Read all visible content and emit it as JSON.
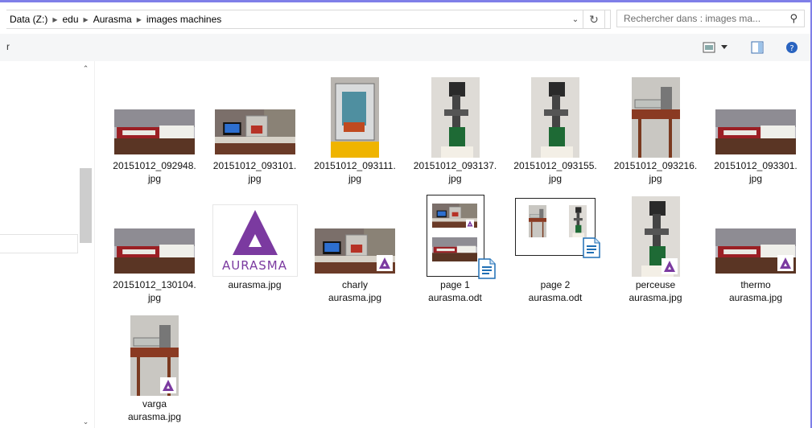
{
  "breadcrumb": [
    "Data (Z:)",
    "edu",
    "Aurasma",
    "images machines"
  ],
  "search": {
    "placeholder": "Rechercher dans : images ma..."
  },
  "toolbar": {
    "truncated_label": "r"
  },
  "colors": {
    "accent_border": "#7f7fe8",
    "aurasma_purple": "#7b3aa0",
    "scrollbar_thumb": "#cdcdcd"
  },
  "icons": [
    "chevron-right-icon",
    "dropdown-arrow-icon",
    "refresh-icon",
    "search-icon",
    "view-options-icon",
    "preview-pane-icon",
    "help-icon",
    "writer-document-icon",
    "aurasma-badge-icon"
  ],
  "files": [
    {
      "line1": "20151012_092948.",
      "line2": "jpg",
      "thumb": "wide-table",
      "badge": false
    },
    {
      "line1": "20151012_093101.",
      "line2": "jpg",
      "thumb": "wide-computer",
      "badge": false
    },
    {
      "line1": "20151012_093111.",
      "line2": "jpg",
      "thumb": "tall-machine-box",
      "badge": false
    },
    {
      "line1": "20151012_093137.",
      "line2": "jpg",
      "thumb": "tall-drill",
      "badge": false
    },
    {
      "line1": "20151012_093155.",
      "line2": "jpg",
      "thumb": "tall-drill",
      "badge": false
    },
    {
      "line1": "20151012_093216.",
      "line2": "jpg",
      "thumb": "tall-bench",
      "badge": false
    },
    {
      "line1": "20151012_093301.",
      "line2": "jpg",
      "thumb": "wide-table",
      "badge": false
    },
    {
      "line1": "20151012_130104.",
      "line2": "jpg",
      "thumb": "wide-table",
      "badge": false
    },
    {
      "line1": "aurasma.jpg",
      "line2": "",
      "thumb": "logo",
      "badge": false
    },
    {
      "line1": "charly",
      "line2": "aurasma.jpg",
      "thumb": "wide-computer",
      "badge": true
    },
    {
      "line1": "page 1",
      "line2": "aurasma.odt",
      "thumb": "doc-page1",
      "badge": false
    },
    {
      "line1": "page 2",
      "line2": "aurasma.odt",
      "thumb": "doc-page2",
      "badge": false
    },
    {
      "line1": "perceuse",
      "line2": "aurasma.jpg",
      "thumb": "tall-drill",
      "badge": true
    },
    {
      "line1": "thermo",
      "line2": "aurasma.jpg",
      "thumb": "wide-table",
      "badge": true
    },
    {
      "line1": "varga",
      "line2": "aurasma.jpg",
      "thumb": "tall-bench",
      "badge": true
    }
  ],
  "logo_text": "AURASMA"
}
